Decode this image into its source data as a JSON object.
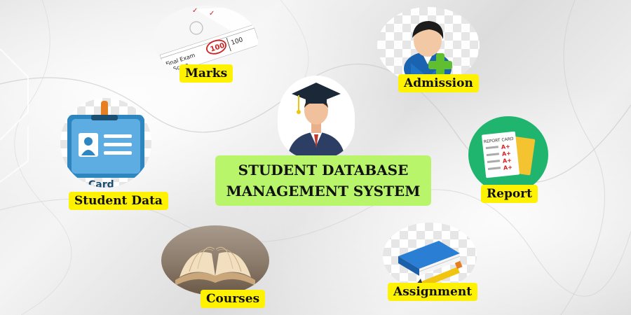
{
  "title": {
    "line1": "STUDENT DATABASE",
    "line2": "MANAGEMENT SYSTEM"
  },
  "nodes": {
    "marks": {
      "label": "Marks",
      "icon": "exam-score-icon",
      "exam_text_1": "Final Exam",
      "exam_text_2": "Score",
      "score": "100",
      "total": "100"
    },
    "admission": {
      "label": "Admission",
      "icon": "add-user-icon"
    },
    "student_data": {
      "label": "Student Data",
      "icon": "id-card-icon",
      "card_text": "Card"
    },
    "report": {
      "label": "Report",
      "icon": "report-card-icon",
      "card_title": "REPORT CARD",
      "grade": "A+"
    },
    "courses": {
      "label": "Courses",
      "icon": "open-book-icon"
    },
    "assignment": {
      "label": "Assignment",
      "icon": "book-pencil-icon"
    },
    "graduate": {
      "icon": "graduate-icon"
    }
  },
  "colors": {
    "label_bg": "#fff200",
    "title_bg": "#b8f56a",
    "report_circle": "#1fb56f",
    "id_card_blue": "#2e86c1"
  }
}
